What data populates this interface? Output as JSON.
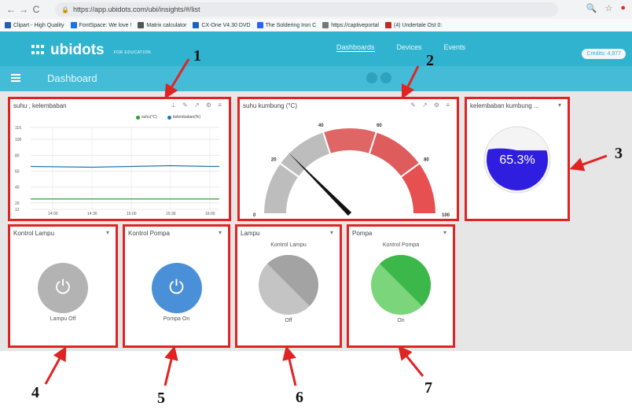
{
  "browser": {
    "url": "https://app.ubidots.com/ubi/insights/#/list",
    "bookmarks": [
      "Clipart - High Quality",
      "FontSpace: We love !",
      "Matrix calculator",
      "CX-One V4.30 DVD",
      "The Soldering Iron C",
      "https://captiveportal",
      "(4) Undertale Ost 0:"
    ]
  },
  "app": {
    "logo": "ubidots",
    "logo_sub": "FOR EDUCATION",
    "nav": [
      "Dashboards",
      "Devices",
      "Events"
    ],
    "credits": "Credits: 4,977",
    "page_title": "Dashboard"
  },
  "widgets": {
    "chart": {
      "title": "suhu , kelembaban",
      "icons": "⊥ ✎ ↗ ⚙ ≡"
    },
    "gauge": {
      "title": "suhu kumbung (°C)",
      "icons": "✎ ↗ ⚙ ≡",
      "ticks": [
        "0",
        "20",
        "40",
        "60",
        "80",
        "100"
      ],
      "value": 25
    },
    "tank": {
      "title": "kelembaban kumbung ...",
      "caret": "▾",
      "value_text": "65.3%",
      "level": 0.653
    },
    "lampu_switch": {
      "title": "Kontrol Lampu",
      "caret": "▾",
      "state": "Lampu Off",
      "power_icon": "⏻",
      "color": "#b3b3b3"
    },
    "pompa_switch": {
      "title": "Kontrol Pompa",
      "caret": "▾",
      "state": "Pompa On",
      "power_icon": "⏻",
      "color": "#4a90d9"
    },
    "lampu_indicator": {
      "title": "Lampu",
      "caret": "▾",
      "label": "Kontrol Lampu",
      "state": "Off",
      "color_light": "#c4c4c4",
      "color_dark": "#a3a3a3"
    },
    "pompa_indicator": {
      "title": "Pompa",
      "caret": "▾",
      "label": "Kontrol Pompa",
      "state": "On",
      "color_light": "#7bd67b",
      "color_dark": "#3cb84a"
    }
  },
  "annotations": [
    "1",
    "2",
    "3",
    "4",
    "5",
    "6",
    "7"
  ],
  "chart_data": {
    "type": "line",
    "x": [
      "14:00",
      "14:30",
      "15:00",
      "15:30",
      "16:00"
    ],
    "ylim": [
      12,
      115
    ],
    "yticks": [
      "115",
      "100",
      "80",
      "60",
      "40",
      "20",
      "12"
    ],
    "series": [
      {
        "name": "suhu(°C)",
        "color": "#2ca02c",
        "values": [
          25,
          25,
          25,
          25,
          25
        ]
      },
      {
        "name": "kelembaban(%)",
        "color": "#1f77b4",
        "values": [
          66,
          65,
          66,
          67,
          66
        ]
      }
    ],
    "grid": true,
    "legend": "top-right"
  }
}
